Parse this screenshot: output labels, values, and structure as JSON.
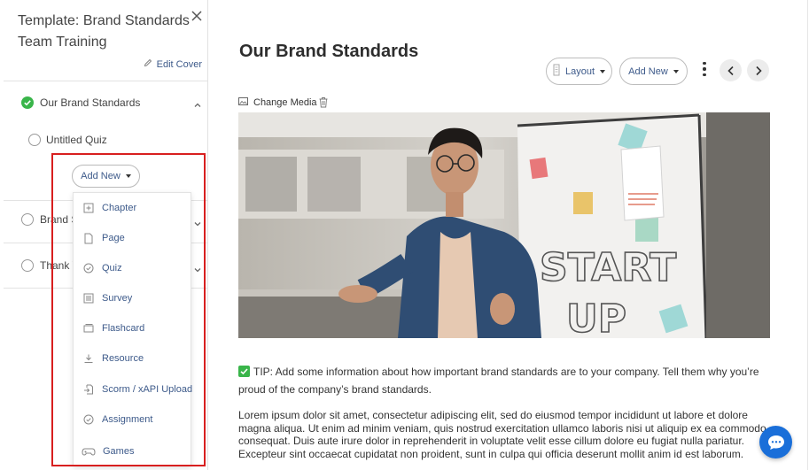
{
  "sidebar": {
    "title": "Template: Brand Standards Team Training",
    "edit_cover": "Edit Cover",
    "items": [
      {
        "label": "Our Brand Standards",
        "status": "complete"
      },
      {
        "label": "Untitled Quiz",
        "status": "incomplete"
      },
      {
        "label": "Brand S",
        "status": "incomplete"
      },
      {
        "label": "Thank Y",
        "status": "incomplete"
      }
    ],
    "add_new": "Add New",
    "add_menu": [
      {
        "label": "Chapter",
        "icon": "chapter-icon"
      },
      {
        "label": "Page",
        "icon": "page-icon"
      },
      {
        "label": "Quiz",
        "icon": "quiz-icon"
      },
      {
        "label": "Survey",
        "icon": "survey-icon"
      },
      {
        "label": "Flashcard",
        "icon": "flashcard-icon"
      },
      {
        "label": "Resource",
        "icon": "resource-icon"
      },
      {
        "label": "Scorm / xAPI Upload",
        "icon": "upload-icon"
      },
      {
        "label": "Assignment",
        "icon": "assignment-icon"
      },
      {
        "label": "Games",
        "icon": "gamepad-icon"
      }
    ]
  },
  "main": {
    "title": "Our Brand Standards",
    "toolbar": {
      "layout": "Layout",
      "add_new": "Add New"
    },
    "change_media": "Change Media",
    "tip": "TIP: Add some information about how important brand standards are to your company. Tell them why you’re proud of the company’s brand standards.",
    "lorem": "Lorem ipsum dolor sit amet, consectetur adipiscing elit, sed do eiusmod tempor incididunt ut labore et dolore magna aliqua. Ut enim ad minim veniam, quis nostrud exercitation ullamco laboris nisi ut aliquip ex ea commodo consequat. Duis aute irure dolor in reprehenderit in voluptate velit esse cillum dolore eu fugiat nulla pariatur. Excepteur sint occaecat cupidatat non proident, sunt in culpa qui officia deserunt mollit anim id est laborum."
  },
  "colors": {
    "accent": "#3d5a8a",
    "success": "#39b54a",
    "highlight": "#d81f1f",
    "chat": "#1a6fd9"
  }
}
